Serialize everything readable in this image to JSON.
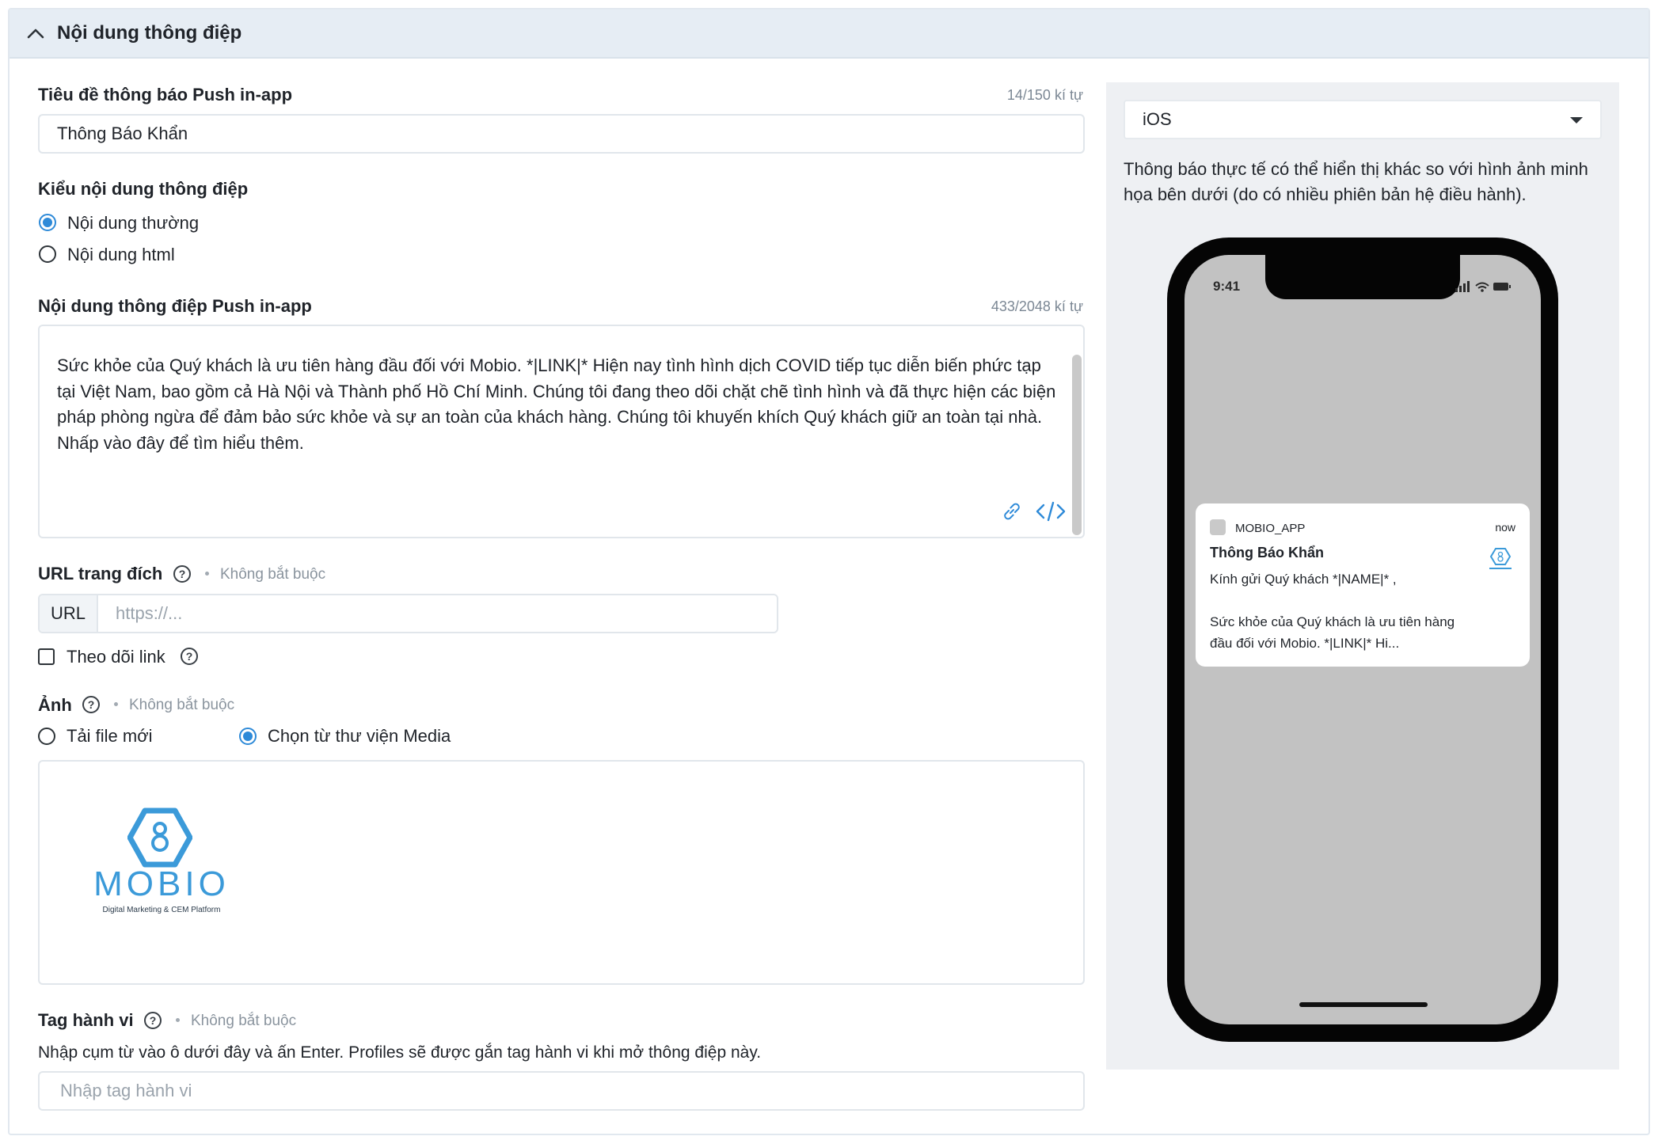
{
  "section": {
    "title": "Nội dung thông điệp",
    "collapse_icon": "chevron-up-icon"
  },
  "title_field": {
    "label": "Tiêu đề thông báo Push in-app",
    "counter": "14/150 kí tự",
    "value": "Thông Báo Khẩn"
  },
  "content_type": {
    "label": "Kiểu nội dung thông điệp",
    "options": [
      {
        "label": "Nội dung thường",
        "selected": true
      },
      {
        "label": "Nội dung html",
        "selected": false
      }
    ]
  },
  "message": {
    "label": "Nội dung thông điệp Push in-app",
    "counter": "433/2048 kí tự",
    "value": "Sức khỏe của Quý khách là ưu tiên hàng đầu đối với Mobio. *|LINK|* Hiện nay tình hình dịch COVID tiếp tục diễn biến phức tạp tại Việt Nam, bao gồm cả Hà Nội và Thành phố Hồ Chí Minh. Chúng tôi đang theo dõi chặt chẽ tình hình và đã thực hiện các biện pháp phòng ngừa để đảm bảo sức khỏe và sự an toàn của khách hàng. Chúng tôi khuyến khích Quý khách giữ an toàn tại nhà.\nNhấp vào đây để tìm hiểu thêm.",
    "tools": [
      "link-icon",
      "code-icon"
    ]
  },
  "url_field": {
    "label": "URL trang đích",
    "optional": "Không bắt buộc",
    "addon": "URL",
    "placeholder": "https://..."
  },
  "track_link": {
    "label": "Theo dõi link",
    "checked": false
  },
  "image": {
    "label": "Ảnh",
    "optional": "Không bắt buộc",
    "options": [
      {
        "label": "Tải file mới",
        "selected": false
      },
      {
        "label": "Chọn từ thư viện Media",
        "selected": true
      }
    ],
    "logo": {
      "name": "MOBIO",
      "tagline": "Digital Marketing & CEM Platform"
    }
  },
  "tags": {
    "label": "Tag hành vi",
    "optional": "Không bắt buộc",
    "hint": "Nhập cụm từ vào ô dưới đây và ấn Enter. Profiles sẽ được gắn tag hành vi khi mở thông điệp này.",
    "placeholder": "Nhập tag hành vi"
  },
  "preview": {
    "platform": "iOS",
    "note": "Thông báo thực tế có thể hiển thị khác so với hình ảnh minh họa bên dưới (do có nhiều phiên bản hệ điều hành).",
    "phone_time": "9:41",
    "notification": {
      "app_name": "MOBIO_APP",
      "time": "now",
      "title": "Thông Báo Khẩn",
      "body": "Kính gửi Quý khách *|NAME|* ,\n\nSức khỏe của Quý khách là ưu tiên hàng đầu đối với Mobio. *|LINK|* Hi..."
    }
  },
  "colors": {
    "accent": "#2e8ad8",
    "header_bg": "#e6edf4",
    "preview_bg": "#eef0f3",
    "phone_screen": "#c2c2c2"
  }
}
